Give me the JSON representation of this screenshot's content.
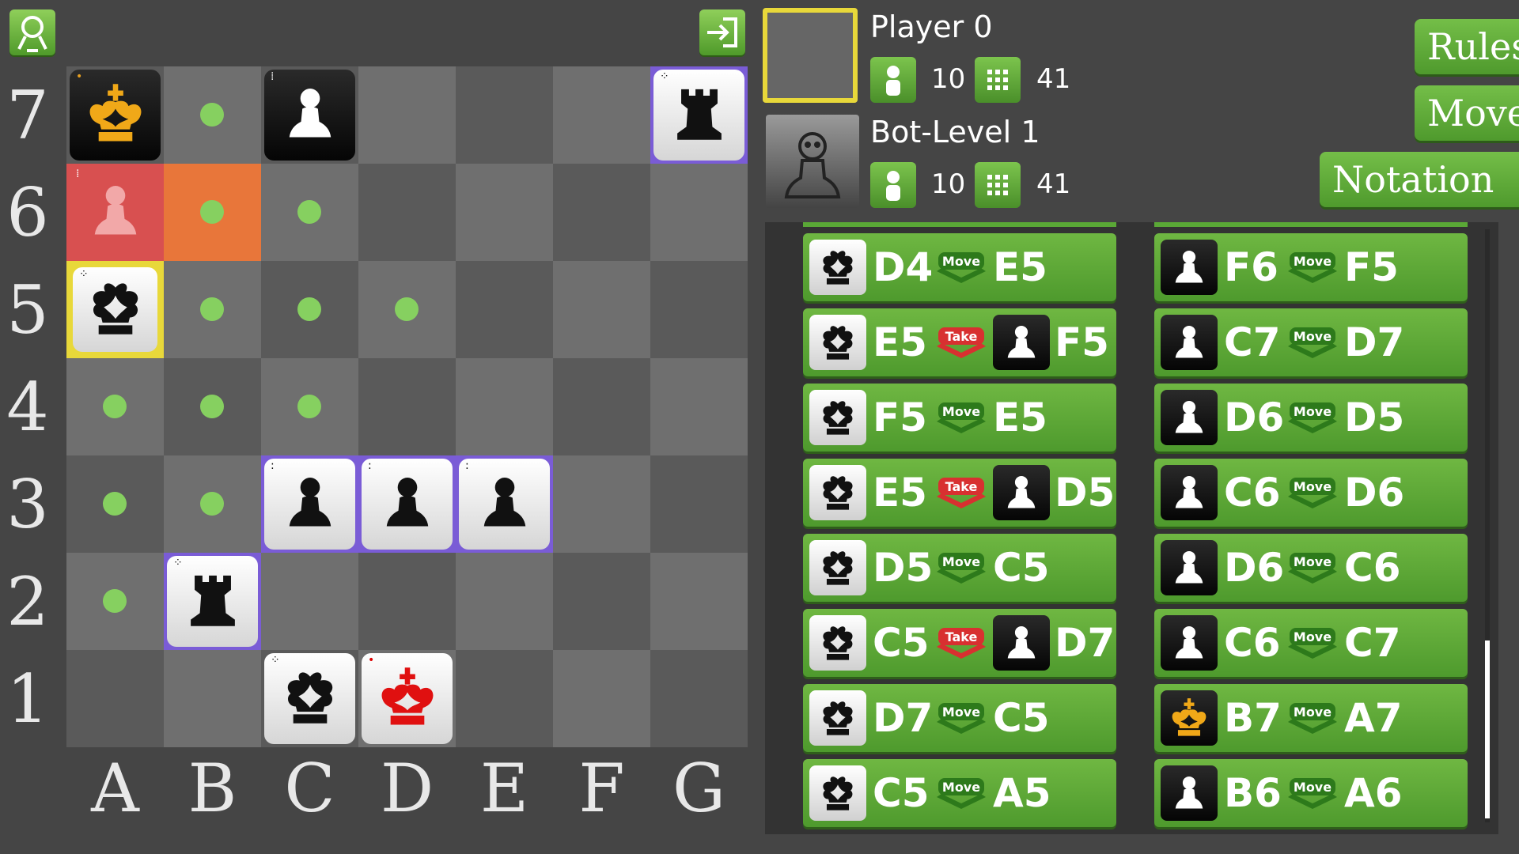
{
  "board": {
    "files": [
      "A",
      "B",
      "C",
      "D",
      "E",
      "F",
      "G"
    ],
    "ranks": [
      "7",
      "6",
      "5",
      "4",
      "3",
      "2",
      "1"
    ]
  },
  "players": {
    "player": {
      "name": "Player 0",
      "pieces_count": "10",
      "moves_count": "41"
    },
    "bot": {
      "name": "Bot-Level 1",
      "pieces_count": "10",
      "moves_count": "41"
    }
  },
  "buttons": {
    "rules": "Rules",
    "move": "Move",
    "notation": "Notation"
  },
  "labels": {
    "move": "Move",
    "take": "Take"
  },
  "colors": {
    "green": "#5aa836",
    "highlight_yellow": "#e8d83a",
    "highlight_purple": "#7a5cd6",
    "last_move_red": "#d85050",
    "last_move_orange": "#e8763a",
    "dot": "#86d060"
  },
  "moves_left": [
    {
      "piece": "queen",
      "from": "D4",
      "action": "Move",
      "to": "E5"
    },
    {
      "piece": "queen",
      "from": "E5",
      "action": "Take",
      "captured": "pawn",
      "to": "F5"
    },
    {
      "piece": "queen",
      "from": "F5",
      "action": "Move",
      "to": "E5"
    },
    {
      "piece": "queen",
      "from": "E5",
      "action": "Take",
      "captured": "pawn",
      "to": "D5"
    },
    {
      "piece": "queen",
      "from": "D5",
      "action": "Move",
      "to": "C5"
    },
    {
      "piece": "queen",
      "from": "C5",
      "action": "Take",
      "captured": "pawn",
      "to": "D7"
    },
    {
      "piece": "queen",
      "from": "D7",
      "action": "Move",
      "to": "C5"
    },
    {
      "piece": "queen",
      "from": "C5",
      "action": "Move",
      "to": "A5"
    }
  ],
  "moves_right": [
    {
      "piece": "pawn",
      "from": "F6",
      "action": "Move",
      "to": "F5"
    },
    {
      "piece": "pawn",
      "from": "C7",
      "action": "Move",
      "to": "D7"
    },
    {
      "piece": "pawn",
      "from": "D6",
      "action": "Move",
      "to": "D5"
    },
    {
      "piece": "pawn",
      "from": "C6",
      "action": "Move",
      "to": "D6"
    },
    {
      "piece": "pawn",
      "from": "D6",
      "action": "Move",
      "to": "C6"
    },
    {
      "piece": "pawn",
      "from": "C6",
      "action": "Move",
      "to": "C7"
    },
    {
      "piece": "king-gold",
      "from": "B7",
      "action": "Move",
      "to": "A7"
    },
    {
      "piece": "pawn",
      "from": "B6",
      "action": "Move",
      "to": "A6"
    }
  ]
}
